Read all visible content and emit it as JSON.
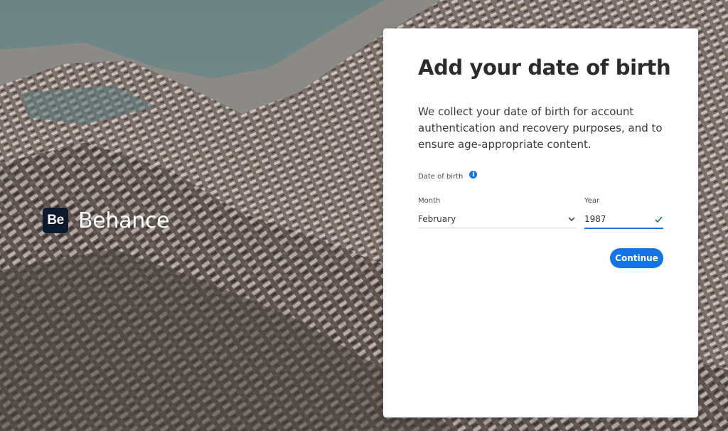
{
  "brand": {
    "logo_text": "Be",
    "name": "Behance"
  },
  "card": {
    "title": "Add your date of birth",
    "description": "We collect your date of birth for account authentication and recovery purposes, and to ensure age-appropriate content.",
    "dob_label": "Date of birth",
    "info_icon": "info-icon",
    "month": {
      "label": "Month",
      "value": "February",
      "icon": "chevron-down-icon"
    },
    "year": {
      "label": "Year",
      "value": "1987",
      "icon": "checkmark-icon"
    },
    "continue_label": "Continue"
  },
  "colors": {
    "accent": "#1473e6",
    "valid": "#12805c",
    "logo_bg": "#0d1a2e"
  }
}
